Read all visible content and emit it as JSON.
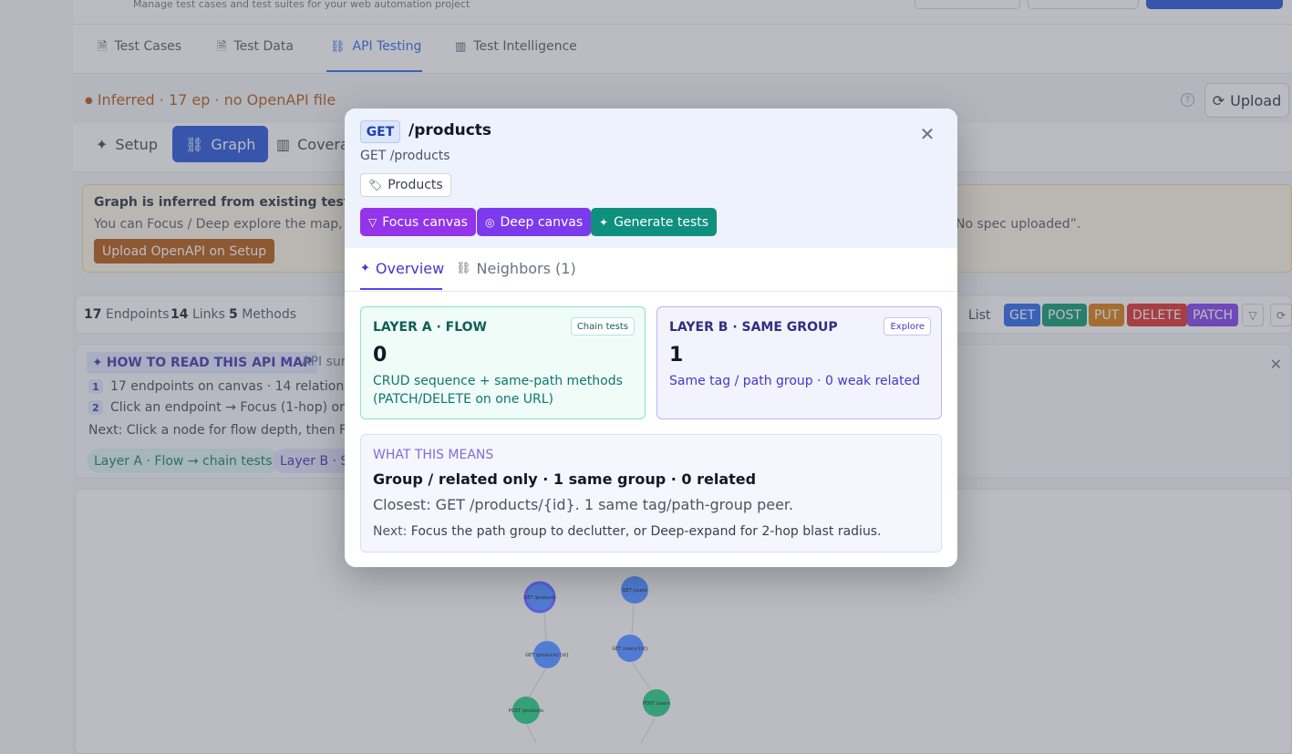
{
  "topbar": {
    "subtitle": "Manage test cases and test suites for your web automation project"
  },
  "tabs": [
    {
      "label": "Test Cases",
      "icon": "file-icon"
    },
    {
      "label": "Test Data",
      "icon": "file-data-icon"
    },
    {
      "label": "API Testing",
      "icon": "network-icon",
      "active": true
    },
    {
      "label": "Test Intelligence",
      "icon": "bar-chart-icon"
    }
  ],
  "status": {
    "inferred_text": "Inferred · 17 ep · no OpenAPI file",
    "upload_label": "Upload"
  },
  "subtabs": [
    {
      "label": "Setup",
      "icon": "sparkle-icon"
    },
    {
      "label": "Graph",
      "icon": "network-icon",
      "active": true
    },
    {
      "label": "Coverag",
      "icon": "bar-chart-icon"
    }
  ],
  "notice": {
    "title": "Graph is inferred from existing tests (17 er",
    "body_left": "You can Focus / Deep explore the map, but C",
    "body_right": "No spec uploaded”.",
    "button": "Upload OpenAPI on Setup"
  },
  "stats": {
    "endpoints_count": "17",
    "endpoints_label": "Endpoints",
    "links_count": "14",
    "links_label": "Links",
    "methods_count": "5",
    "methods_label": "Methods",
    "list_label": "List",
    "methods": [
      {
        "label": "GET",
        "color": "#2563eb"
      },
      {
        "label": "POST",
        "color": "#059669"
      },
      {
        "label": "PUT",
        "color": "#d97706"
      },
      {
        "label": "DELETE",
        "color": "#dc2626"
      },
      {
        "label": "PATCH",
        "color": "#7c3aed"
      }
    ]
  },
  "howto": {
    "title": "HOW TO READ THIS API MAP",
    "title_tail": "API surf",
    "step1_num": "1",
    "step1": "17 endpoints on canvas · 14 relationships",
    "step2_num": "2",
    "step2": "Click an endpoint → Focus (1-hop) or Dee",
    "next": "Next: Click a node for flow depth, then Focus",
    "pill_a": "Layer A · Flow → chain tests",
    "pill_b": "Layer B · Sa"
  },
  "graph_nodes": [
    {
      "label": "GET /products",
      "color": "#3b6fd8"
    },
    {
      "label": "GET /products/{id}",
      "color": "#3b6fd8"
    },
    {
      "label": "POST /products",
      "color": "#1a9b6a"
    },
    {
      "label": "GET /users",
      "color": "#3b6fd8"
    },
    {
      "label": "GET /users/{id}",
      "color": "#3b6fd8"
    },
    {
      "label": "POST /users",
      "color": "#1a9b6a"
    }
  ],
  "modal": {
    "method": "GET",
    "title": "/products",
    "path": "GET /products",
    "tag": "Products",
    "actions": {
      "focus": "Focus canvas",
      "deep": "Deep canvas",
      "generate": "Generate tests"
    },
    "tabs": {
      "overview": "Overview",
      "neighbors": "Neighbors (1)"
    },
    "layer_a": {
      "title": "LAYER A · FLOW",
      "button": "Chain tests",
      "count": "0",
      "desc": "CRUD sequence + same-path methods (PATCH/DELETE on one URL)"
    },
    "layer_b": {
      "title": "LAYER B · SAME GROUP",
      "button": "Explore",
      "count": "1",
      "desc": "Same tag / path group · 0 weak related"
    },
    "means": {
      "heading": "WHAT THIS MEANS",
      "headline": "Group / related only · 1 same group · 0 related",
      "closest": "Closest: GET /products/{id}. 1 same tag/path-group peer.",
      "next_label": "Next:",
      "next_text": "Focus the path group to declutter, or Deep-expand for 2-hop blast radius."
    }
  }
}
